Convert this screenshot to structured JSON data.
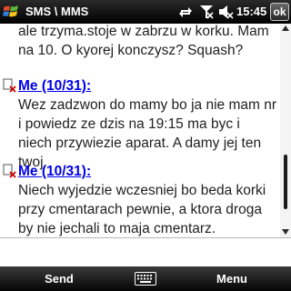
{
  "titlebar": {
    "title": "SMS \\ MMS",
    "time": "15:45",
    "ok_label": "ok",
    "icons": [
      "windows-start-icon",
      "sync-arrows-icon",
      "signal-off-icon",
      "speaker-muted-icon"
    ]
  },
  "conversation": {
    "continued_text": "ale trzyma.stoje w zabrzu w korku. Mam na 10. O kyorej konczysz? Squash?",
    "messages": [
      {
        "sender": "Me (10/31):",
        "text": "Wez zadzwon do mamy bo ja nie mam nr i powiedz ze dzis na 19:15 ma byc i niech przywiezie aparat. A damy jej ten twoj."
      },
      {
        "sender": "Me (10/31):",
        "text": "Niech wyjedzie wczesniej bo beda korki przy cmentarach pewnie, a ktora droga by nie jechali to maja cmentarz."
      }
    ]
  },
  "scrollbar": {
    "position": 0.87,
    "visible_fraction": 0.28
  },
  "compose": {
    "value": "",
    "placeholder": ""
  },
  "softkeys": {
    "left": "Send",
    "right": "Menu"
  },
  "colors": {
    "sender_link": "#0000ee",
    "bar_background": "#000000",
    "message_error_icon": "#cc0000"
  }
}
